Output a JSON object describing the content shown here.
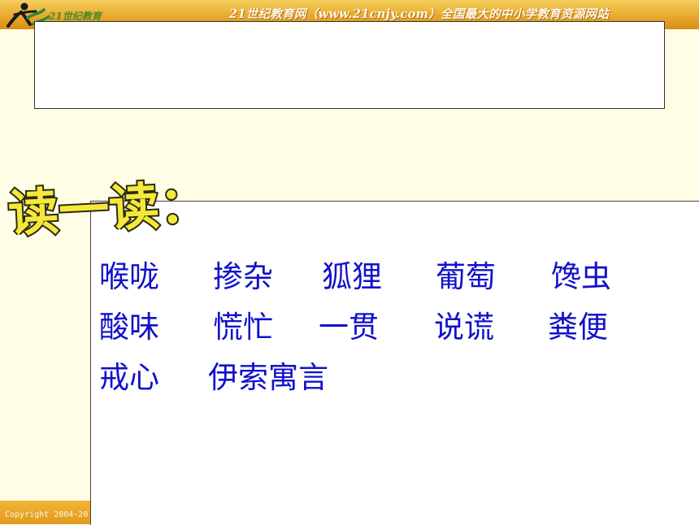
{
  "header": {
    "logo_text": "21世纪教育",
    "site_banner": "21世纪教育网（www.21cnjy.com）全国最大的中小学教育资源网站",
    "copyright": "Copyright 2004-20"
  },
  "heading": {
    "text": "读一读："
  },
  "vocabulary": {
    "rows": [
      [
        "喉咙",
        "掺杂",
        "狐狸",
        "葡萄",
        "馋虫"
      ],
      [
        "酸味",
        "慌忙",
        "一贯",
        "说谎",
        "粪便"
      ],
      [
        "戒心",
        "伊索寓言"
      ]
    ]
  },
  "colors": {
    "header_orange": "#e7a62a",
    "page_background": "#fffde6",
    "vocab_blue": "#1111cc",
    "heading_yellow": "#f6e83a",
    "heading_outline": "#2a2a10"
  }
}
